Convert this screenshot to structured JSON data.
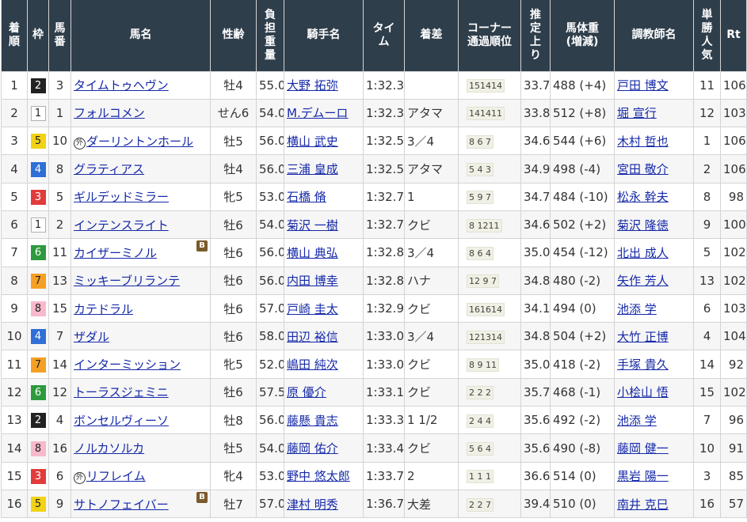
{
  "headers": {
    "rank": "着順",
    "waku": "枠",
    "umaban": "馬番",
    "horse": "馬名",
    "sexage": "性齢",
    "weight": "負担重量",
    "jockey": "騎手名",
    "time": "タイム",
    "margin": "着差",
    "corner": "コーナー通過順位",
    "last3f": "推定上り",
    "bodyweight": "馬体重(増減)",
    "trainer": "調教師名",
    "pop": "単勝人気",
    "rt": "Rt"
  },
  "header_lines": {
    "rank": [
      "着",
      "順"
    ],
    "waku": [
      "枠"
    ],
    "umaban": [
      "馬",
      "番"
    ],
    "horse": [
      "馬名"
    ],
    "sexage": [
      "性齢"
    ],
    "weight": [
      "負",
      "担",
      "重",
      "量"
    ],
    "jockey": [
      "騎手名"
    ],
    "time": [
      "タイ",
      "ム"
    ],
    "margin": [
      "着差"
    ],
    "corner": [
      "コーナー",
      "通過順位"
    ],
    "last3f": [
      "推",
      "定",
      "上",
      "り"
    ],
    "bodyweight": [
      "馬体重",
      "(増減)"
    ],
    "trainer": [
      "調教師名"
    ],
    "pop": [
      "単",
      "勝",
      "人",
      "気"
    ],
    "rt": [
      "Rt"
    ]
  },
  "waku_colors": {
    "1": {
      "bg": "#ffffff",
      "fg": "#222222"
    },
    "2": {
      "bg": "#222222",
      "fg": "#ffffff"
    },
    "3": {
      "bg": "#e23b3b",
      "fg": "#ffffff"
    },
    "4": {
      "bg": "#2f6fd6",
      "fg": "#ffffff"
    },
    "5": {
      "bg": "#f2d215",
      "fg": "#222222"
    },
    "6": {
      "bg": "#2e9a3e",
      "fg": "#ffffff"
    },
    "7": {
      "bg": "#f5a024",
      "fg": "#222222"
    },
    "8": {
      "bg": "#f7b9cc",
      "fg": "#222222"
    }
  },
  "rows": [
    {
      "rank": "1",
      "waku": "2",
      "umaban": "3",
      "mark": "",
      "horse": "タイムトゥヘヴン",
      "blinker": false,
      "sexage": "牡4",
      "weight": "55.0",
      "jockey": "大野 拓弥",
      "time": "1:32.3",
      "margin": "",
      "corner": "151414",
      "last3f": "33.7",
      "bodyweight": "488 (+4)",
      "trainer": "戸田 博文",
      "pop": "11",
      "rt": "106"
    },
    {
      "rank": "2",
      "waku": "1",
      "umaban": "1",
      "mark": "",
      "horse": "フォルコメン",
      "blinker": false,
      "sexage": "せん6",
      "weight": "54.0",
      "jockey": "M.デムーロ",
      "time": "1:32.3",
      "margin": "アタマ",
      "corner": "141411",
      "last3f": "33.8",
      "bodyweight": "512 (+8)",
      "trainer": "堀 宣行",
      "pop": "12",
      "rt": "103"
    },
    {
      "rank": "3",
      "waku": "5",
      "umaban": "10",
      "mark": "外",
      "horse": "ダーリントンホール",
      "blinker": false,
      "sexage": "牡5",
      "weight": "56.0",
      "jockey": "横山 武史",
      "time": "1:32.5",
      "margin": "3／4",
      "corner": "8 6 7",
      "last3f": "34.6",
      "bodyweight": "544 (+6)",
      "trainer": "木村 哲也",
      "pop": "1",
      "rt": "106"
    },
    {
      "rank": "4",
      "waku": "4",
      "umaban": "8",
      "mark": "",
      "horse": "グラティアス",
      "blinker": false,
      "sexage": "牡4",
      "weight": "56.0",
      "jockey": "三浦 皇成",
      "time": "1:32.5",
      "margin": "アタマ",
      "corner": "5 4 3",
      "last3f": "34.9",
      "bodyweight": "498 (-4)",
      "trainer": "宮田 敬介",
      "pop": "2",
      "rt": "106"
    },
    {
      "rank": "5",
      "waku": "3",
      "umaban": "5",
      "mark": "",
      "horse": "ギルデッドミラー",
      "blinker": false,
      "sexage": "牝5",
      "weight": "53.0",
      "jockey": "石橋 脩",
      "time": "1:32.7",
      "margin": "1",
      "corner": "5 9 7",
      "last3f": "34.7",
      "bodyweight": "484 (-10)",
      "trainer": "松永 幹夫",
      "pop": "8",
      "rt": "98"
    },
    {
      "rank": "6",
      "waku": "1",
      "umaban": "2",
      "mark": "",
      "horse": "インテンスライト",
      "blinker": false,
      "sexage": "牡6",
      "weight": "54.0",
      "jockey": "菊沢 一樹",
      "time": "1:32.7",
      "margin": "クビ",
      "corner": "8 1211",
      "last3f": "34.6",
      "bodyweight": "502 (+2)",
      "trainer": "菊沢 隆徳",
      "pop": "9",
      "rt": "100"
    },
    {
      "rank": "7",
      "waku": "6",
      "umaban": "11",
      "mark": "",
      "horse": "カイザーミノル",
      "blinker": true,
      "sexage": "牡6",
      "weight": "56.0",
      "jockey": "横山 典弘",
      "time": "1:32.8",
      "margin": "3／4",
      "corner": "8 6 4",
      "last3f": "35.0",
      "bodyweight": "454 (-12)",
      "trainer": "北出 成人",
      "pop": "5",
      "rt": "102"
    },
    {
      "rank": "8",
      "waku": "7",
      "umaban": "13",
      "mark": "",
      "horse": "ミッキーブリランテ",
      "blinker": false,
      "sexage": "牡6",
      "weight": "56.0",
      "jockey": "内田 博幸",
      "time": "1:32.8",
      "margin": "ハナ",
      "corner": "12 9 7",
      "last3f": "34.8",
      "bodyweight": "480 (-2)",
      "trainer": "矢作 芳人",
      "pop": "13",
      "rt": "102"
    },
    {
      "rank": "9",
      "waku": "8",
      "umaban": "15",
      "mark": "",
      "horse": "カテドラル",
      "blinker": false,
      "sexage": "牡6",
      "weight": "57.0",
      "jockey": "戸崎 圭太",
      "time": "1:32.9",
      "margin": "クビ",
      "corner": "161614",
      "last3f": "34.1",
      "bodyweight": "494 (0)",
      "trainer": "池添 学",
      "pop": "6",
      "rt": "103"
    },
    {
      "rank": "10",
      "waku": "4",
      "umaban": "7",
      "mark": "",
      "horse": "ザダル",
      "blinker": false,
      "sexage": "牡6",
      "weight": "58.0",
      "jockey": "田辺 裕信",
      "time": "1:33.0",
      "margin": "3／4",
      "corner": "121314",
      "last3f": "34.8",
      "bodyweight": "504 (+2)",
      "trainer": "大竹 正博",
      "pop": "4",
      "rt": "104"
    },
    {
      "rank": "11",
      "waku": "7",
      "umaban": "14",
      "mark": "",
      "horse": "インターミッション",
      "blinker": false,
      "sexage": "牝5",
      "weight": "52.0",
      "jockey": "嶋田 純次",
      "time": "1:33.0",
      "margin": "クビ",
      "corner": "8 9 11",
      "last3f": "35.0",
      "bodyweight": "418 (-2)",
      "trainer": "手塚 貴久",
      "pop": "14",
      "rt": "92"
    },
    {
      "rank": "12",
      "waku": "6",
      "umaban": "12",
      "mark": "",
      "horse": "トーラスジェミニ",
      "blinker": false,
      "sexage": "牡6",
      "weight": "57.5",
      "jockey": "原 優介",
      "time": "1:33.1",
      "margin": "クビ",
      "corner": "2 2 2",
      "last3f": "35.7",
      "bodyweight": "468 (-1)",
      "trainer": "小桧山 悟",
      "pop": "15",
      "rt": "102"
    },
    {
      "rank": "13",
      "waku": "2",
      "umaban": "4",
      "mark": "",
      "horse": "ボンセルヴィーソ",
      "blinker": false,
      "sexage": "牡8",
      "weight": "56.0",
      "jockey": "藤懸 貴志",
      "time": "1:33.3",
      "margin": "1 1/2",
      "corner": "2 4 4",
      "last3f": "35.6",
      "bodyweight": "492 (-2)",
      "trainer": "池添 学",
      "pop": "7",
      "rt": "96"
    },
    {
      "rank": "14",
      "waku": "8",
      "umaban": "16",
      "mark": "",
      "horse": "ノルカソルカ",
      "blinker": false,
      "sexage": "牡5",
      "weight": "54.0",
      "jockey": "藤岡 佑介",
      "time": "1:33.4",
      "margin": "クビ",
      "corner": "5 6 4",
      "last3f": "35.6",
      "bodyweight": "490 (-8)",
      "trainer": "藤岡 健一",
      "pop": "10",
      "rt": "91"
    },
    {
      "rank": "15",
      "waku": "3",
      "umaban": "6",
      "mark": "外",
      "horse": "リフレイム",
      "blinker": false,
      "sexage": "牝4",
      "weight": "53.0",
      "jockey": "野中 悠太郎",
      "time": "1:33.7",
      "margin": "2",
      "corner": "1 1 1",
      "last3f": "36.6",
      "bodyweight": "514 (0)",
      "trainer": "黒岩 陽一",
      "pop": "3",
      "rt": "85"
    },
    {
      "rank": "16",
      "waku": "5",
      "umaban": "9",
      "mark": "",
      "horse": "サトノフェイバー",
      "blinker": true,
      "sexage": "牡7",
      "weight": "57.0",
      "jockey": "津村 明秀",
      "time": "1:36.7",
      "margin": "大差",
      "corner": "2 2 7",
      "last3f": "39.4",
      "bodyweight": "510 (0)",
      "trainer": "南井 克巳",
      "pop": "16",
      "rt": "57"
    }
  ],
  "blinker_label": "B"
}
